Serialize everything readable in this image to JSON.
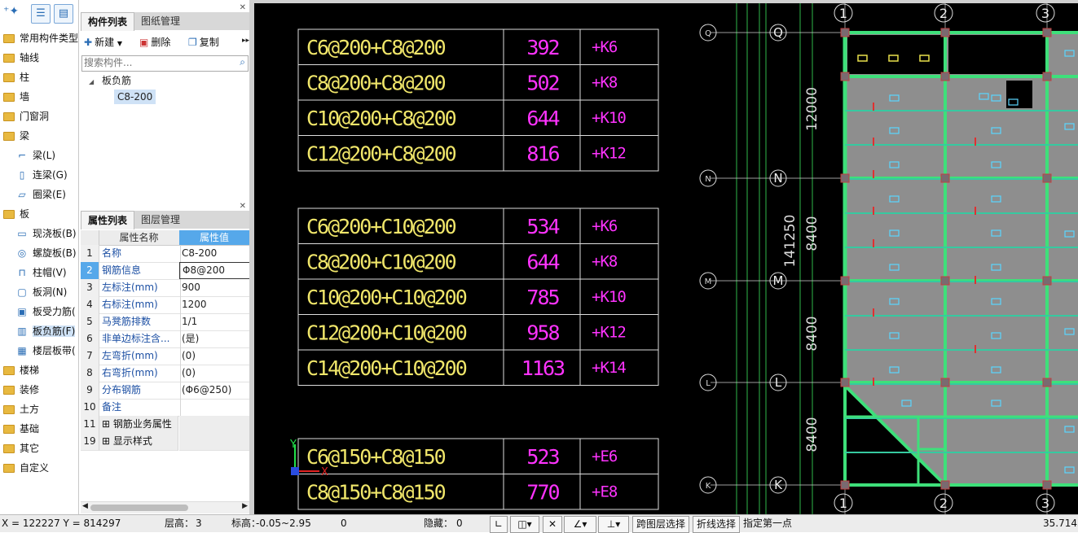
{
  "left_tree": {
    "toolbar_icons": [
      "tree-expand-icon",
      "list-view-icon",
      "detail-view-icon"
    ],
    "items": [
      {
        "label": "常用构件类型",
        "type": "folder"
      },
      {
        "label": "轴线",
        "type": "folder"
      },
      {
        "label": "柱",
        "type": "folder"
      },
      {
        "label": "墙",
        "type": "folder"
      },
      {
        "label": "门窗洞",
        "type": "folder"
      },
      {
        "label": "梁",
        "type": "folder"
      },
      {
        "label": "梁(L)",
        "type": "child"
      },
      {
        "label": "连梁(G)",
        "type": "child"
      },
      {
        "label": "圈梁(E)",
        "type": "child"
      },
      {
        "label": "板",
        "type": "folder"
      },
      {
        "label": "现浇板(B)",
        "type": "child"
      },
      {
        "label": "螺旋板(B)",
        "type": "child"
      },
      {
        "label": "柱帽(V)",
        "type": "child"
      },
      {
        "label": "板洞(N)",
        "type": "child"
      },
      {
        "label": "板受力筋(",
        "type": "child"
      },
      {
        "label": "板负筋(F)",
        "type": "child",
        "selected": true
      },
      {
        "label": "楼层板带(",
        "type": "child"
      },
      {
        "label": "楼梯",
        "type": "folder"
      },
      {
        "label": "装修",
        "type": "folder"
      },
      {
        "label": "土方",
        "type": "folder"
      },
      {
        "label": "基础",
        "type": "folder"
      },
      {
        "label": "其它",
        "type": "folder"
      },
      {
        "label": "自定义",
        "type": "folder"
      }
    ]
  },
  "component_panel": {
    "tabs": [
      "构件列表",
      "图纸管理"
    ],
    "buttons": {
      "new": "新建",
      "delete": "删除",
      "copy": "复制"
    },
    "search_placeholder": "搜索构件...",
    "tree_group": "板负筋",
    "tree_item": "C8-200"
  },
  "property_panel": {
    "tabs": [
      "属性列表",
      "图层管理"
    ],
    "headers": {
      "name": "属性名称",
      "value": "属性值"
    },
    "rows": [
      {
        "num": "1",
        "name": "名称",
        "value": "C8-200"
      },
      {
        "num": "2",
        "name": "钢筋信息",
        "value": "Φ8@200"
      },
      {
        "num": "3",
        "name": "左标注(mm)",
        "value": "900"
      },
      {
        "num": "4",
        "name": "右标注(mm)",
        "value": "1200"
      },
      {
        "num": "5",
        "name": "马凳筋排数",
        "value": "1/1"
      },
      {
        "num": "6",
        "name": "非单边标注含...",
        "value": "(是)"
      },
      {
        "num": "7",
        "name": "左弯折(mm)",
        "value": "(0)"
      },
      {
        "num": "8",
        "name": "右弯折(mm)",
        "value": "(0)"
      },
      {
        "num": "9",
        "name": "分布钢筋",
        "value": "(Φ6@250)"
      },
      {
        "num": "10",
        "name": "备注",
        "value": ""
      },
      {
        "num": "11",
        "name": "钢筋业务属性",
        "value": "",
        "group": true
      },
      {
        "num": "19",
        "name": "显示样式",
        "value": "",
        "group": true
      }
    ]
  },
  "cad": {
    "tables": [
      {
        "rows": [
          {
            "spec": "C6@200+C8@200",
            "area": "392",
            "code": "+K6"
          },
          {
            "spec": "C8@200+C8@200",
            "area": "502",
            "code": "+K8"
          },
          {
            "spec": "C10@200+C8@200",
            "area": "644",
            "code": "+K10"
          },
          {
            "spec": "C12@200+C8@200",
            "area": "816",
            "code": "+K12"
          }
        ]
      },
      {
        "rows": [
          {
            "spec": "C6@200+C10@200",
            "area": "534",
            "code": "+K6"
          },
          {
            "spec": "C8@200+C10@200",
            "area": "644",
            "code": "+K8"
          },
          {
            "spec": "C10@200+C10@200",
            "area": "785",
            "code": "+K10"
          },
          {
            "spec": "C12@200+C10@200",
            "area": "958",
            "code": "+K12"
          },
          {
            "spec": "C14@200+C10@200",
            "area": "1163",
            "code": "+K14"
          }
        ]
      },
      {
        "rows": [
          {
            "spec": "C6@150+C8@150",
            "area": "523",
            "code": "+E6"
          },
          {
            "spec": "C8@150+C8@150",
            "area": "770",
            "code": "+E8"
          }
        ]
      }
    ],
    "axis_top": [
      "1",
      "2",
      "3"
    ],
    "axis_bottom": [
      "1",
      "2",
      "3"
    ],
    "axis_rows": [
      "Q",
      "N",
      "M",
      "L",
      "K"
    ],
    "dims": [
      "12000",
      "141250",
      "8400",
      "8400",
      "8400"
    ],
    "ucs": {
      "y": "Y",
      "x": "X"
    },
    "colors": {
      "table_text": "#f0e66a",
      "area_text": "#ff33ff",
      "code_text": "#ff33ff",
      "green": "#3ee07a",
      "slab": "#8e8e8e"
    }
  },
  "status_bar": {
    "coords": "X = 122227 Y = 814297",
    "floor_label": "层高：",
    "floor_value": "3",
    "elev_label": "标高：",
    "elev_value": "-0.05~2.95",
    "count": "0",
    "hidden_label": "隐藏：",
    "hidden_value": "0",
    "btn_cross_layer": "跨图层选择",
    "btn_polyline": "折线选择",
    "prompt": "指定第一点",
    "scale": "35.7143"
  }
}
